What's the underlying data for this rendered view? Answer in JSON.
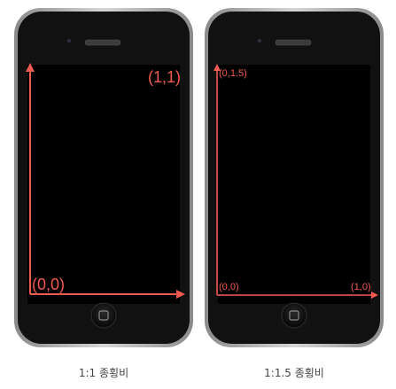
{
  "figures": [
    {
      "origin_label": "(0,0)",
      "corner_label": "(1,1)",
      "caption": "1:1 종횡비"
    },
    {
      "origin_label": "(0,0)",
      "top_label": "(0,1.5)",
      "right_label": "(1,0)",
      "caption": "1:1.5 종횡비"
    }
  ],
  "colors": {
    "axis": "#f05a50",
    "screen": "#000000",
    "bezel": "#111111",
    "frame": "#a8a8a8"
  }
}
